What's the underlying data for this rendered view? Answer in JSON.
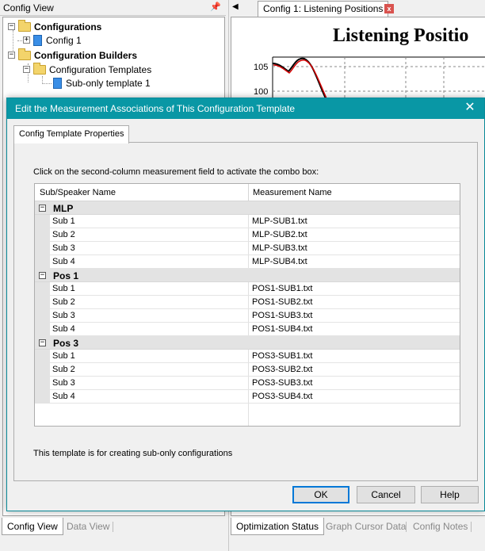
{
  "left_pane": {
    "title": "Config View",
    "pin_icon": "📌",
    "tree": {
      "configurations": "Configurations",
      "config1": "Config 1",
      "builders": "Configuration Builders",
      "templates": "Configuration Templates",
      "template1": "Sub-only template 1"
    },
    "bottom_tabs": [
      "Config View",
      "Data View"
    ]
  },
  "right_pane": {
    "doc_tab": "Config 1: Listening Positions",
    "graph_title": "Listening Positio",
    "y_ticks": [
      "105",
      "100"
    ],
    "bottom_tabs": [
      "Optimization Status",
      "Graph Cursor Data",
      "Config Notes"
    ]
  },
  "dialog": {
    "title": "Edit the Measurement Associations of This Configuration Template",
    "close_glyph": "✕",
    "tab": "Config Template Properties",
    "instruction": "Click on the second-column measurement field to activate the combo box:",
    "columns": [
      "Sub/Speaker Name",
      "Measurement Name"
    ],
    "groups": [
      {
        "name": "MLP",
        "rows": [
          {
            "sub": "Sub 1",
            "measurement": "MLP-SUB1.txt"
          },
          {
            "sub": "Sub 2",
            "measurement": "MLP-SUB2.txt"
          },
          {
            "sub": "Sub 3",
            "measurement": "MLP-SUB3.txt"
          },
          {
            "sub": "Sub 4",
            "measurement": "MLP-SUB4.txt"
          }
        ]
      },
      {
        "name": "Pos 1",
        "rows": [
          {
            "sub": "Sub 1",
            "measurement": "POS1-SUB1.txt"
          },
          {
            "sub": "Sub 2",
            "measurement": "POS1-SUB2.txt"
          },
          {
            "sub": "Sub 3",
            "measurement": "POS1-SUB3.txt"
          },
          {
            "sub": "Sub 4",
            "measurement": "POS1-SUB4.txt"
          }
        ]
      },
      {
        "name": "Pos 3",
        "rows": [
          {
            "sub": "Sub 1",
            "measurement": "POS3-SUB1.txt"
          },
          {
            "sub": "Sub 2",
            "measurement": "POS3-SUB2.txt"
          },
          {
            "sub": "Sub 3",
            "measurement": "POS3-SUB3.txt"
          },
          {
            "sub": "Sub 4",
            "measurement": "POS3-SUB4.txt"
          }
        ]
      }
    ],
    "footer_note": "This template is for creating sub-only configurations",
    "buttons": {
      "ok": "OK",
      "cancel": "Cancel",
      "help": "Help"
    }
  },
  "colors": {
    "titlebar": "#0997a5",
    "accent": "#0078d7"
  }
}
